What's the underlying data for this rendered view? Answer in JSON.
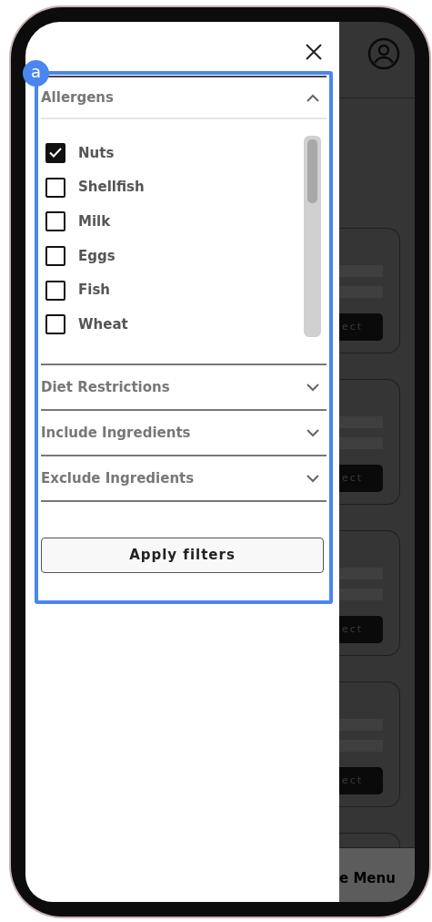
{
  "annotation": {
    "label": "a"
  },
  "drawer": {
    "sections": [
      {
        "title": "Allergens",
        "expanded": true,
        "options": [
          {
            "label": "Nuts",
            "checked": true
          },
          {
            "label": "Shellfish",
            "checked": false
          },
          {
            "label": "Milk",
            "checked": false
          },
          {
            "label": "Eggs",
            "checked": false
          },
          {
            "label": "Fish",
            "checked": false
          },
          {
            "label": "Wheat",
            "checked": false
          }
        ]
      },
      {
        "title": "Diet Restrictions",
        "expanded": false
      },
      {
        "title": "Include Ingredients",
        "expanded": false
      },
      {
        "title": "Exclude Ingredients",
        "expanded": false
      }
    ],
    "apply_button": "Apply filters"
  },
  "background": {
    "cards": [
      {
        "button": "ect"
      },
      {
        "button": "ect"
      },
      {
        "button": "ect"
      },
      {
        "button": "ect"
      }
    ],
    "bottom_bar": "e Menu"
  }
}
